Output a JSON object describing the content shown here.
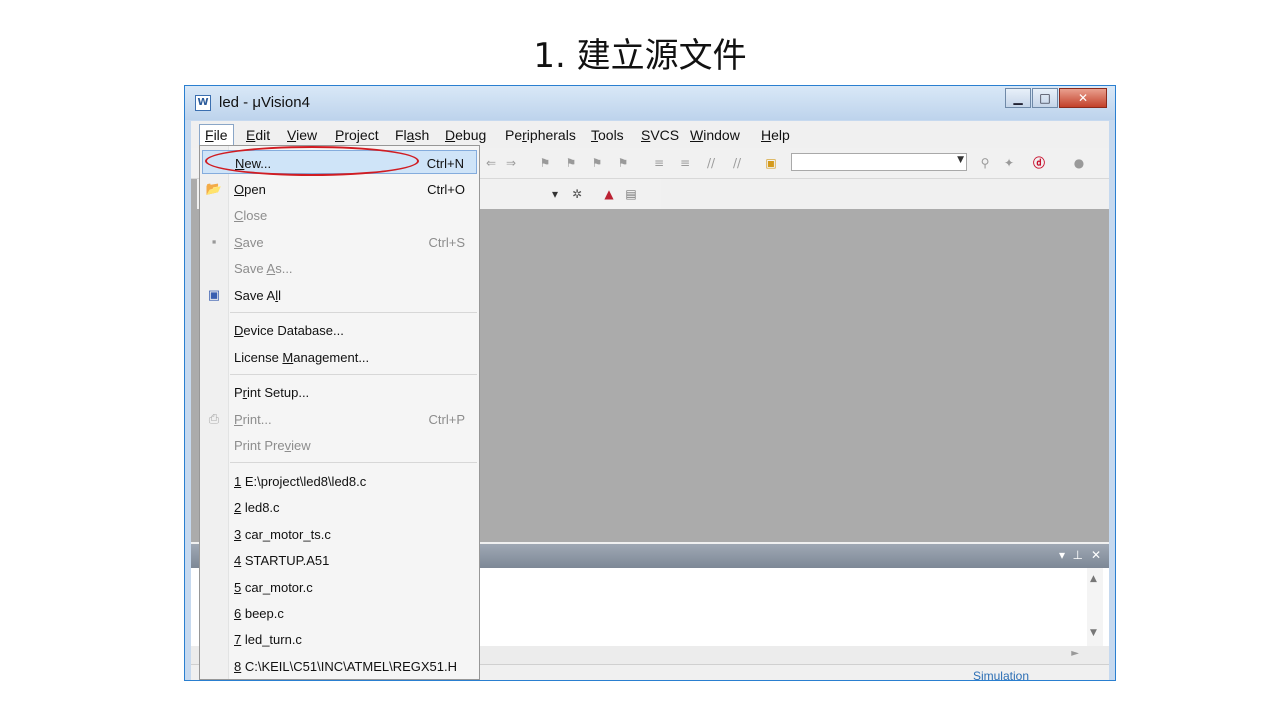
{
  "slide": {
    "title": "1. 建立源文件"
  },
  "window": {
    "title": "led  - μVision4",
    "app_icon_glyph": "W",
    "caption": {
      "minimize": "▁",
      "maximize": "□",
      "close": "✕"
    }
  },
  "menubar": {
    "items": [
      {
        "label": "File",
        "u": "F"
      },
      {
        "label": "Edit",
        "u": "E"
      },
      {
        "label": "View",
        "u": "V"
      },
      {
        "label": "Project",
        "u": "P"
      },
      {
        "label": "Flash"
      },
      {
        "label": "Debug"
      },
      {
        "label": "Peripherals"
      },
      {
        "label": "Tools",
        "u": "T"
      },
      {
        "label": "SVCS",
        "u": "S"
      },
      {
        "label": "Window",
        "u": "W"
      },
      {
        "label": "Help",
        "u": "H"
      }
    ]
  },
  "file_menu": {
    "new": {
      "label": "New...",
      "shortcut": "Ctrl+N"
    },
    "open": {
      "label": "Open",
      "shortcut": "Ctrl+O",
      "icon": "open-folder-icon"
    },
    "close": {
      "label": "Close"
    },
    "save": {
      "label": "Save",
      "shortcut": "Ctrl+S",
      "icon": "save-disk-icon"
    },
    "save_as": {
      "label": "Save As..."
    },
    "save_all": {
      "label": "Save All",
      "icon": "save-all-icon"
    },
    "device_database": {
      "label": "Device Database..."
    },
    "license_management": {
      "label": "License Management..."
    },
    "print_setup": {
      "label": "Print Setup..."
    },
    "print": {
      "label": "Print...",
      "shortcut": "Ctrl+P",
      "icon": "printer-icon"
    },
    "print_preview": {
      "label": "Print Preview"
    },
    "recent_files": [
      {
        "num": "1",
        "label": " E:\\project\\led8\\led8.c"
      },
      {
        "num": "2",
        "label": " led8.c"
      },
      {
        "num": "3",
        "label": " car_motor_ts.c"
      },
      {
        "num": "4",
        "label": " STARTUP.A51"
      },
      {
        "num": "5",
        "label": " car_motor.c"
      },
      {
        "num": "6",
        "label": " beep.c"
      },
      {
        "num": "7",
        "label": " led_turn.c"
      },
      {
        "num": "8",
        "label": " C:\\KEIL\\C51\\INC\\ATMEL\\REGX51.H"
      }
    ]
  },
  "panel": {
    "controls": {
      "dropdown": "▾",
      "pin": "⊥",
      "close": "✕"
    }
  },
  "statusbar": {
    "mode": "Simulation"
  },
  "colors": {
    "highlight": "#cfe4f8",
    "annotation": "#d01c22",
    "workspace": "#ababab"
  }
}
